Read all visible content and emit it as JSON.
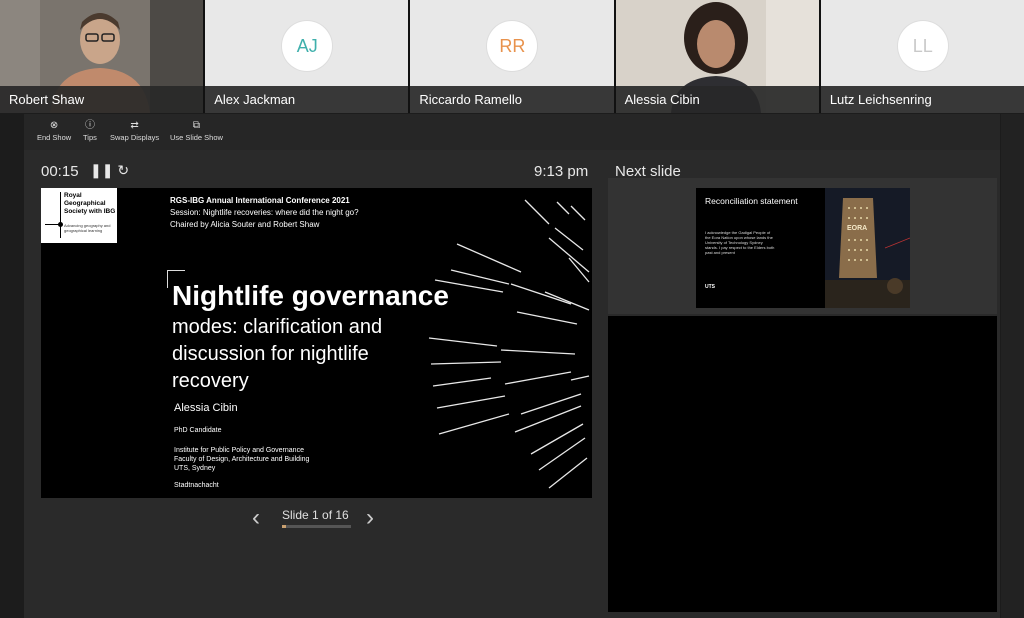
{
  "participants": [
    {
      "name": "Robert Shaw",
      "initials": "",
      "video": true
    },
    {
      "name": "Alex Jackman",
      "initials": "AJ",
      "video": false,
      "color": "#3fb0ac"
    },
    {
      "name": "Riccardo Ramello",
      "initials": "RR",
      "video": false,
      "color": "#e8924c"
    },
    {
      "name": "Alessia Cibin",
      "initials": "",
      "video": true
    },
    {
      "name": "Lutz Leichsenring",
      "initials": "LL",
      "video": false,
      "color": "#c9c9c9"
    }
  ],
  "toolbar": {
    "end_show": "End Show",
    "tips": "Tips",
    "swap_displays": "Swap Displays",
    "use_slide_show": "Use Slide Show"
  },
  "timer": {
    "elapsed": "00:15",
    "controls": "❚❚ ↻"
  },
  "clock": "9:13 pm",
  "next_slide_label": "Next slide",
  "slide": {
    "logo_text": "Royal Geographical Society with IBG",
    "logo_tagline": "Advancing geography and geographical learning",
    "conference": "RGS-IBG Annual International Conference 2021",
    "session": "Session: Nightlife recoveries: where did the night go?",
    "chairs": "Chaired by Alicia Souter and Robert Shaw",
    "title_bold": "Nightlife governance",
    "title_rest": "modes: clarification and discussion for nightlife recovery",
    "author": "Alessia Cibin",
    "role": "PhD Candidate",
    "affil1": "Institute for Public Policy and Governance",
    "affil2": "Faculty of Design, Architecture and Building",
    "affil3": "UTS, Sydney",
    "org": "Stadtnachacht"
  },
  "navigation": {
    "counter": "Slide 1 of 16",
    "current": 1,
    "total": 16,
    "progress": 0.0625,
    "prev_icon": "‹",
    "next_icon": "›"
  },
  "next_slide": {
    "title": "Reconciliation statement",
    "body": "I acknowledge the Gadigal People of the Eora Nation upon whose lands the University of Technology Sydney stands. I pay respect to the Elders both past and present",
    "uts": "UTS",
    "photo_text": "EORA"
  }
}
